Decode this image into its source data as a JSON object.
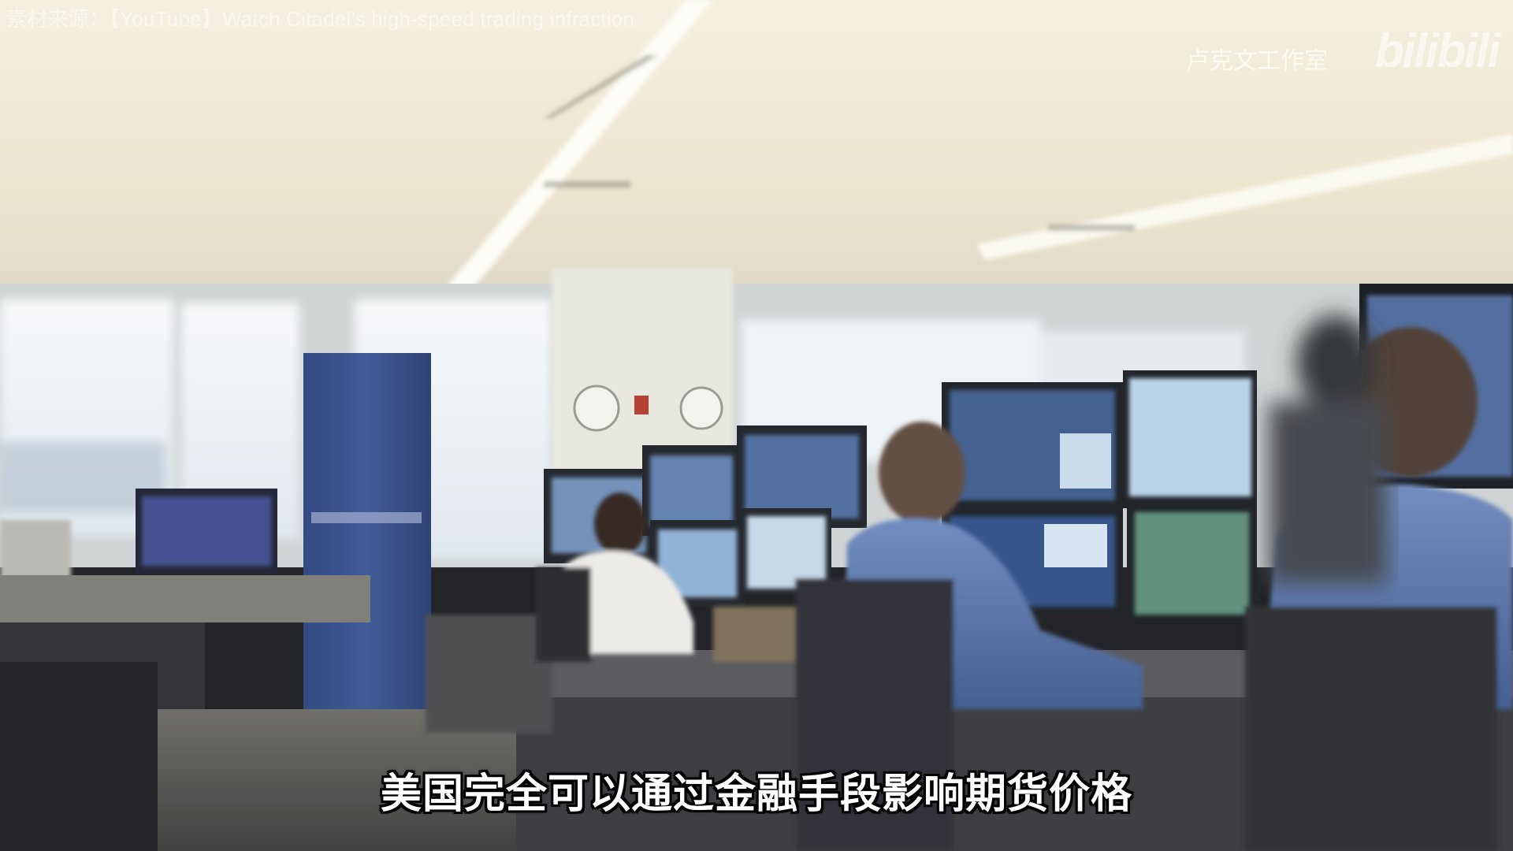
{
  "overlay": {
    "source_credit": "素材来源：【YouTube】Watch Citadel's high-speed trading infraction",
    "channel_name": "卢克文工作室",
    "platform_logo": "bilibili"
  },
  "subtitle": "美国完全可以通过金融手段影响期货价格",
  "colors": {
    "ceiling": "#efe9d8",
    "window_light": "#f3f6f8",
    "pillar_blue": "#2f4a86",
    "desk_dark": "#3a3b3f",
    "monitor_frame": "#1f2226",
    "screen_blue": "#5d7fb6",
    "subtitle_text": "#ffffff",
    "subtitle_outline": "#000000"
  }
}
